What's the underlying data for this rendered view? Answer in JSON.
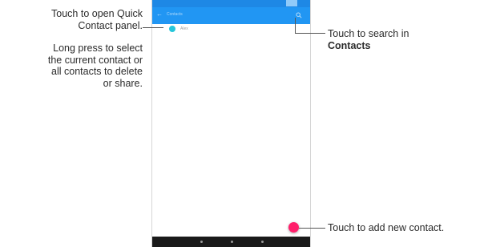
{
  "callouts": {
    "quick_contact": [
      "Touch to open Quick",
      "Contact panel."
    ],
    "long_press": [
      "Long press to select",
      "the current contact or",
      "all contacts to delete",
      "or share."
    ],
    "search": {
      "line1": "Touch to search in",
      "line2": "Contacts"
    },
    "add": "Touch to add new contact."
  },
  "phone": {
    "app_bar": {
      "menu_icon": "arrow-icon",
      "title": "Contacts",
      "search_icon": "search-icon"
    },
    "contact": {
      "name": "Alex"
    },
    "fab_icon": "add-icon",
    "colors": {
      "status_bar": "#1e88e5",
      "app_bar": "#2196f3",
      "avatar": "#26c6da",
      "fab": "#ff1f6b",
      "nav_bar": "#1a1a1a"
    }
  }
}
